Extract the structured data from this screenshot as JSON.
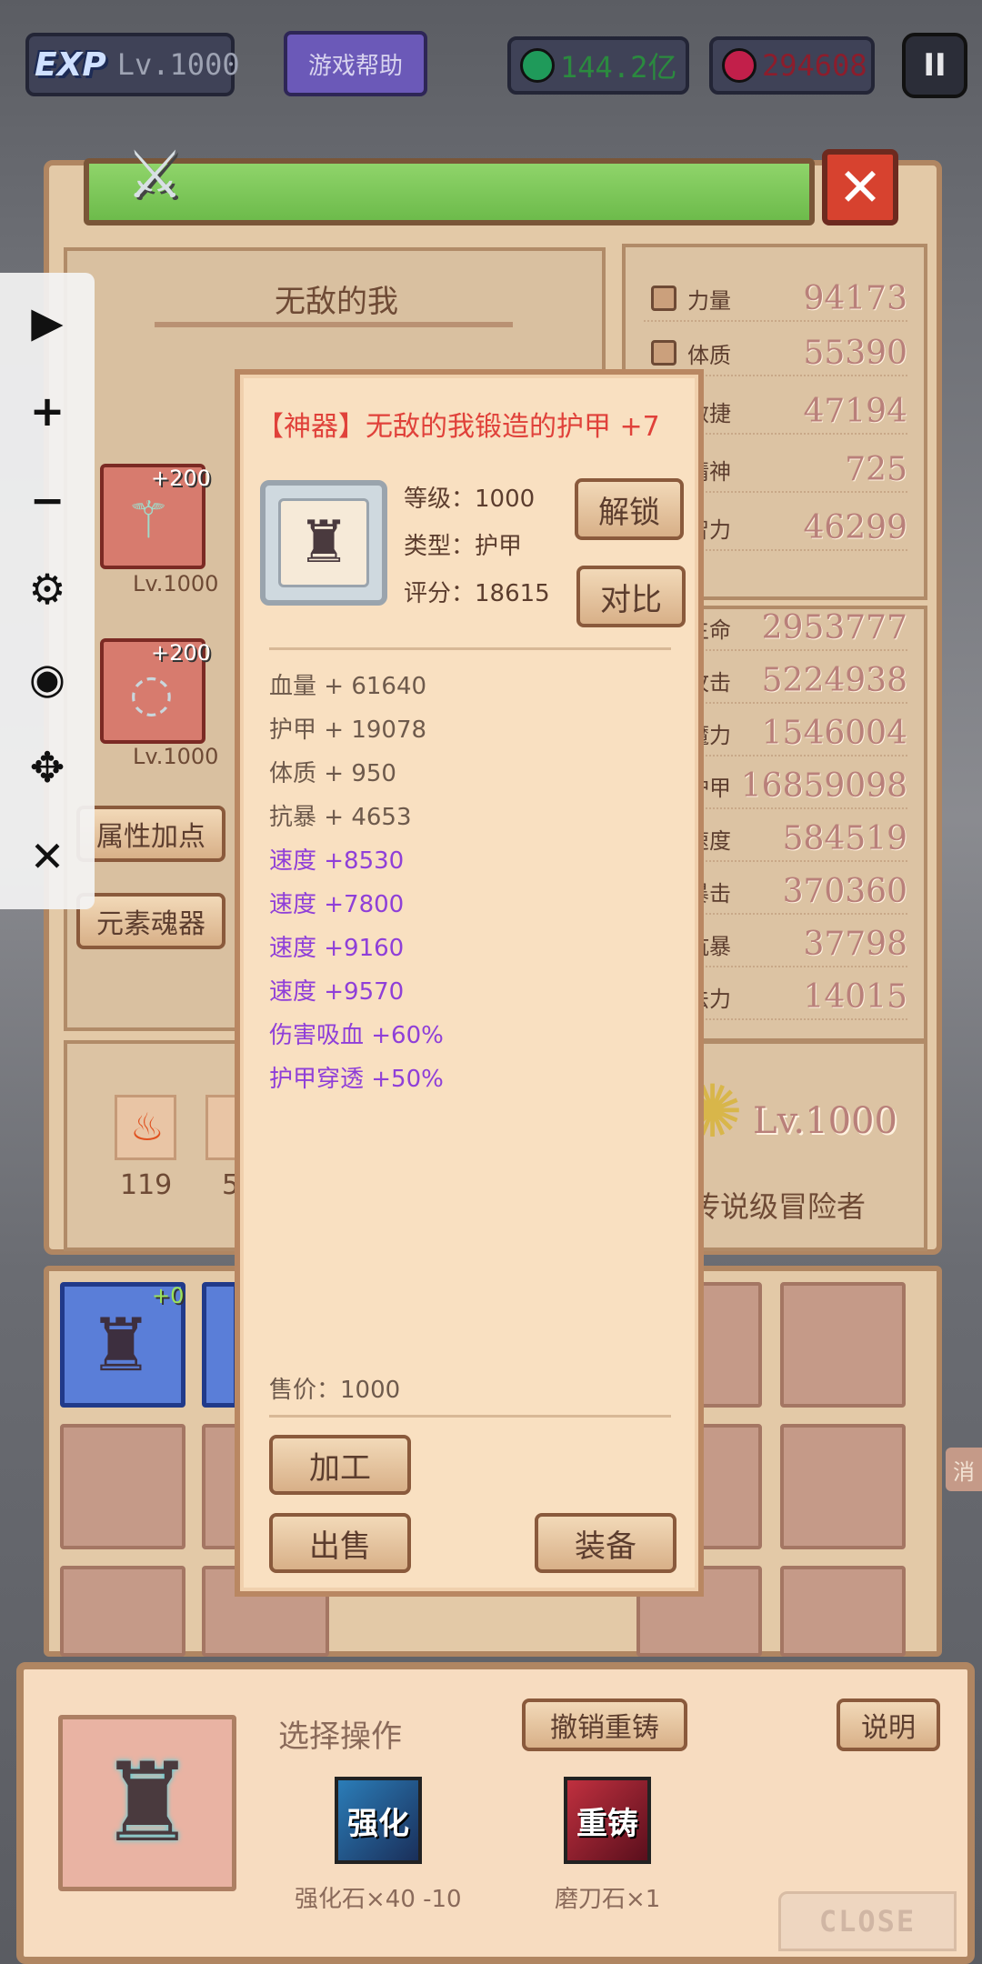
{
  "hud": {
    "exp_logo": "EXP",
    "level": "Lv.1000",
    "help_label": "游戏帮助",
    "green_currency": "144.2亿",
    "red_currency": "294608",
    "pause_label": "II"
  },
  "character": {
    "name": "无敌的我",
    "weapon_slot": {
      "bonus": "+200",
      "level": "Lv.1000"
    },
    "ring_slot": {
      "bonus": "+200",
      "level": "Lv.1000"
    },
    "attr_points_button": "属性加点",
    "element_button": "元素魂器",
    "elements": [
      {
        "count": "119"
      },
      {
        "count": "5"
      }
    ],
    "big_level": "Lv.1000",
    "rank": "传说级冒险者"
  },
  "stats_primary": [
    {
      "name": "力量",
      "value": "94173"
    },
    {
      "name": "体质",
      "value": "55390"
    },
    {
      "name": "敏捷",
      "value": "47194"
    },
    {
      "name": "精神",
      "value": "725"
    },
    {
      "name": "智力",
      "value": "46299"
    }
  ],
  "stats_secondary": [
    {
      "name": "生命",
      "value": "2953777"
    },
    {
      "name": "攻击",
      "value": "5224938"
    },
    {
      "name": "魔力",
      "value": "1546004"
    },
    {
      "name": "护甲",
      "value": "16859098"
    },
    {
      "name": "速度",
      "value": "584519"
    },
    {
      "name": "暴击",
      "value": "370360"
    },
    {
      "name": "抗暴",
      "value": "37798"
    },
    {
      "name": "法力",
      "value": "14015"
    }
  ],
  "inventory": {
    "first_item_badge": "+0",
    "side_tab": "消"
  },
  "toolbar": [
    "play-icon",
    "plus-icon",
    "minus-icon",
    "gear-icon",
    "eye-icon",
    "move-icon",
    "close-icon"
  ],
  "popup": {
    "title": "【神器】无敌的我锻造的护甲 +7",
    "level_line": "等级：1000",
    "type_line": "类型：护甲",
    "score_line": "评分：18615",
    "unlock_button": "解锁",
    "compare_button": "对比",
    "base_attrs": [
      "血量 + 61640",
      "护甲 + 19078",
      "体质 + 950",
      "抗暴 + 4653"
    ],
    "bonus_attrs": [
      "速度 +8530",
      "速度 +7800",
      "速度 +9160",
      "速度 +9570",
      "伤害吸血 +60%",
      "护甲穿透 +50%"
    ],
    "price": "售价：1000",
    "process_button": "加工",
    "sell_button": "出售",
    "equip_button": "装备"
  },
  "operation": {
    "title": "选择操作",
    "undo_reforge_button": "撤销重铸",
    "help_button": "说明",
    "enhance_icon_text": "强化",
    "enhance_label": "强化石×40 -10",
    "reforge_icon_text": "重铸",
    "reforge_label": "磨刀石×1",
    "close_label": "CLOSE"
  },
  "colors": {
    "legendary_title": "#e0413a",
    "bonus_attr": "#8f3fd8",
    "panel": "#e3c9a7"
  }
}
